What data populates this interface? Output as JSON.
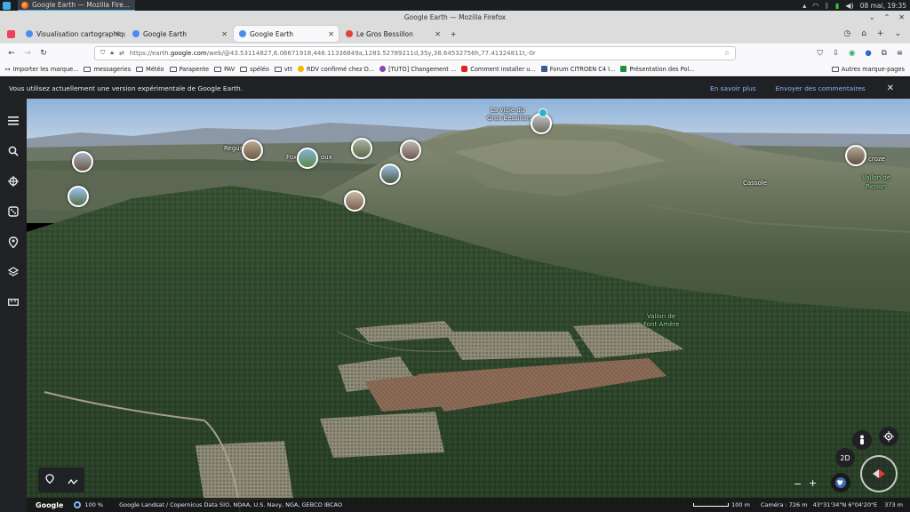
{
  "taskbar": {
    "task_label": "Google Earth — Mozilla Fire...",
    "clock": "08 mai, 19:35"
  },
  "window": {
    "title": "Google Earth — Mozilla Firefox"
  },
  "tabs": [
    {
      "label": "Visualisation cartographique",
      "favicon_color": "#4c8bf5"
    },
    {
      "label": "Google Earth",
      "favicon_color": "#4c8bf5"
    },
    {
      "label": "Google Earth",
      "favicon_color": "#4c8bf5",
      "active": true
    },
    {
      "label": "Le Gros Bessillon",
      "favicon_color": "#e0413b"
    }
  ],
  "nav": {
    "url_prefix": "https://earth.",
    "url_domain": "google.com",
    "url_rest": "/web/@43.53114827,6.06671918,446.11336849a,1283.52789211d,35y,38.64532756h,77.41324811t,-0r"
  },
  "bookmarks": [
    {
      "label": "Importer les marque...",
      "kind": "folder"
    },
    {
      "label": "messageries",
      "kind": "folder"
    },
    {
      "label": "Météo",
      "kind": "folder"
    },
    {
      "label": "Parapente",
      "kind": "folder"
    },
    {
      "label": "PAV",
      "kind": "folder"
    },
    {
      "label": "spéléo",
      "kind": "folder"
    },
    {
      "label": "vtt",
      "kind": "folder"
    },
    {
      "label": "RDV confirmé chez D...",
      "kind": "site",
      "color": "#f4b400"
    },
    {
      "label": "[TUTO] Changement ...",
      "kind": "site",
      "color": "#8e44ad"
    },
    {
      "label": "Comment installer u...",
      "kind": "site",
      "color": "#e62117"
    },
    {
      "label": "Forum CITROEN C4 I...",
      "kind": "site",
      "color": "#3b5998"
    },
    {
      "label": "Présentation des Pol...",
      "kind": "site",
      "color": "#1e8e3e"
    }
  ],
  "bookmarks_other": "Autres marque-pages",
  "banner": {
    "message": "Vous utilisez actuellement une version expérimentale de Google Earth.",
    "learn_more": "En savoir plus",
    "feedback": "Envoyer des commentaires"
  },
  "map": {
    "labels": {
      "summit": "La vigie du",
      "summit2": "Gros Bessillon",
      "regusse": "Regus",
      "fox": "Fox",
      "fox2": "oux",
      "cassole": "Cassole",
      "crose": "croze",
      "picoun": "Vallon de",
      "picoun2": "Picoun",
      "font_amere": "Vallon de",
      "font_amere2": "Font Amère"
    },
    "mode_2d": "2D"
  },
  "status": {
    "logo": "Google",
    "zoom": "100 %",
    "attribution": "Google   Landsat / Copernicus   Data SIO, NOAA, U.S. Navy, NGA, GEBCO   IBCAO",
    "scale": "100 m",
    "camera": "Caméra : 726 m",
    "coords": "43°31'34\"N 6°04'20\"E",
    "altitude": "373 m"
  }
}
